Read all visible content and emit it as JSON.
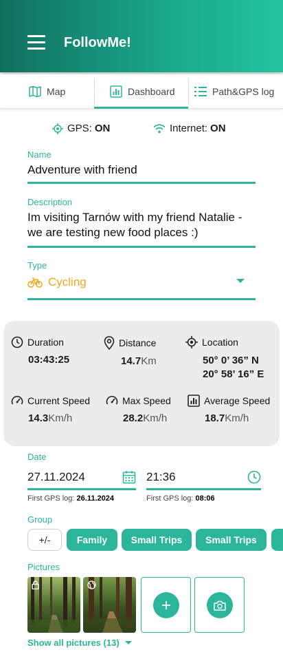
{
  "app": {
    "title": "FollowMe!"
  },
  "tabs": [
    {
      "label": "Map",
      "icon": "map-icon"
    },
    {
      "label": "Dashboard",
      "icon": "bar-chart-icon",
      "active": true
    },
    {
      "label": "Path&GPS log",
      "icon": "list-icon"
    }
  ],
  "status": {
    "gps_label": "GPS:",
    "gps_value": "ON",
    "internet_label": "Internet:",
    "internet_value": "ON"
  },
  "form": {
    "name_label": "Name",
    "name_value": "Adventure with friend",
    "description_label": "Description",
    "description_value": "Im visiting Tarnów with my friend Natalie - we are testing new food places :)",
    "type_label": "Type",
    "type_value": "Cycling"
  },
  "stats": {
    "duration": {
      "label": "Duration",
      "value": "03:43:25"
    },
    "distance": {
      "label": "Distance",
      "value": "14.7",
      "unit": "Km"
    },
    "location": {
      "label": "Location",
      "lat": "50° 0’ 36” N",
      "lon": "20° 58’ 16” E"
    },
    "current_speed": {
      "label": "Current Speed",
      "value": "14.3",
      "unit": "Km/h"
    },
    "max_speed": {
      "label": "Max Speed",
      "value": "28.2",
      "unit": "Km/h"
    },
    "average_speed": {
      "label": "Average Speed",
      "value": "18.7",
      "unit": "Km/h"
    }
  },
  "datetime": {
    "date_label": "Date",
    "date_value": "27.11.2024",
    "time_value": "21:36",
    "first_log_date_label": "First GPS log:",
    "first_log_date_value": "26.11.2024",
    "first_log_time_label": "First GPS log:",
    "first_log_time_value": "08:06"
  },
  "groups": {
    "label": "Group",
    "toggle_label": "+/-",
    "items": [
      "Family",
      "Small Trips",
      "Small Trips"
    ]
  },
  "pictures": {
    "label": "Pictures",
    "show_all_label": "Show all pictures (13)"
  },
  "colors": {
    "accent": "#2bb59a",
    "header_start": "#10705e",
    "header_end": "#23c3a1",
    "type_orange": "#f2a71b",
    "card_bg": "#ececec"
  }
}
